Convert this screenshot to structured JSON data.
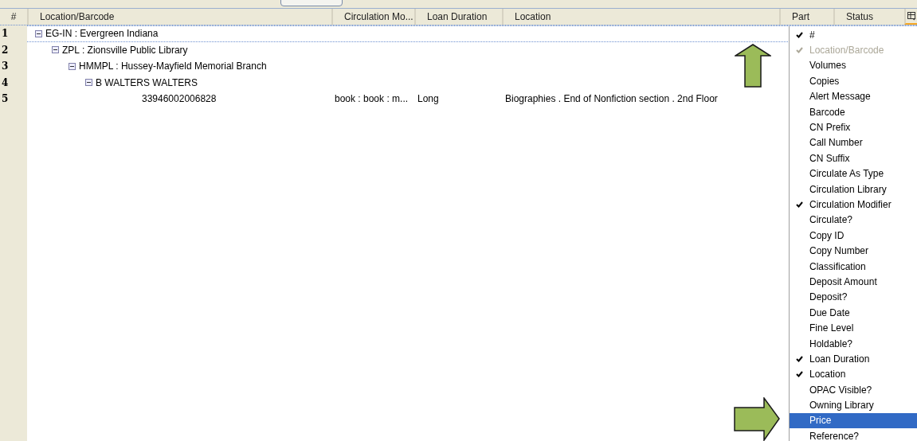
{
  "columns": [
    {
      "label": "#"
    },
    {
      "label": "Location/Barcode"
    },
    {
      "label": "Circulation Mo..."
    },
    {
      "label": "Loan Duration"
    },
    {
      "label": "Location"
    },
    {
      "label": "Part"
    },
    {
      "label": "Status"
    }
  ],
  "tree": [
    {
      "number": "1",
      "label": "EG-IN : Evergreen Indiana",
      "expanded": true,
      "focused": true,
      "children": [
        {
          "number": "2",
          "label": "ZPL : Zionsville Public Library",
          "expanded": true,
          "focused": false,
          "children": [
            {
              "number": "3",
              "label": "HMMPL : Hussey-Mayfield Memorial Branch",
              "expanded": true,
              "focused": false,
              "children": [
                {
                  "number": "4",
                  "label": "B WALTERS WALTERS",
                  "expanded": true,
                  "focused": false,
                  "children": [
                    {
                      "number": "5",
                      "label": "33946002006828",
                      "focused": false,
                      "cells": [
                        "book : book : m...",
                        "Long",
                        "Biographies . End of Nonfiction section . 2nd Floor"
                      ]
                    }
                  ]
                }
              ]
            }
          ]
        }
      ]
    }
  ],
  "column_menu": [
    {
      "label": "#",
      "checked": true,
      "disabled": false,
      "selected": false
    },
    {
      "label": "Location/Barcode",
      "checked": true,
      "disabled": true,
      "selected": false
    },
    {
      "label": "Volumes",
      "checked": false,
      "disabled": false,
      "selected": false
    },
    {
      "label": "Copies",
      "checked": false,
      "disabled": false,
      "selected": false
    },
    {
      "label": "Alert Message",
      "checked": false,
      "disabled": false,
      "selected": false
    },
    {
      "label": "Barcode",
      "checked": false,
      "disabled": false,
      "selected": false
    },
    {
      "label": "CN Prefix",
      "checked": false,
      "disabled": false,
      "selected": false
    },
    {
      "label": "Call Number",
      "checked": false,
      "disabled": false,
      "selected": false
    },
    {
      "label": "CN Suffix",
      "checked": false,
      "disabled": false,
      "selected": false
    },
    {
      "label": "Circulate As Type",
      "checked": false,
      "disabled": false,
      "selected": false
    },
    {
      "label": "Circulation Library",
      "checked": false,
      "disabled": false,
      "selected": false
    },
    {
      "label": "Circulation Modifier",
      "checked": true,
      "disabled": false,
      "selected": false
    },
    {
      "label": "Circulate?",
      "checked": false,
      "disabled": false,
      "selected": false
    },
    {
      "label": "Copy ID",
      "checked": false,
      "disabled": false,
      "selected": false
    },
    {
      "label": "Copy Number",
      "checked": false,
      "disabled": false,
      "selected": false
    },
    {
      "label": "Classification",
      "checked": false,
      "disabled": false,
      "selected": false
    },
    {
      "label": "Deposit Amount",
      "checked": false,
      "disabled": false,
      "selected": false
    },
    {
      "label": "Deposit?",
      "checked": false,
      "disabled": false,
      "selected": false
    },
    {
      "label": "Due Date",
      "checked": false,
      "disabled": false,
      "selected": false
    },
    {
      "label": "Fine Level",
      "checked": false,
      "disabled": false,
      "selected": false
    },
    {
      "label": "Holdable?",
      "checked": false,
      "disabled": false,
      "selected": false
    },
    {
      "label": "Loan Duration",
      "checked": true,
      "disabled": false,
      "selected": false
    },
    {
      "label": "Location",
      "checked": true,
      "disabled": false,
      "selected": false
    },
    {
      "label": "OPAC Visible?",
      "checked": false,
      "disabled": false,
      "selected": false
    },
    {
      "label": "Owning Library",
      "checked": false,
      "disabled": false,
      "selected": false
    },
    {
      "label": "Price",
      "checked": false,
      "disabled": false,
      "selected": true
    },
    {
      "label": "Reference?",
      "checked": false,
      "disabled": false,
      "selected": false
    }
  ]
}
